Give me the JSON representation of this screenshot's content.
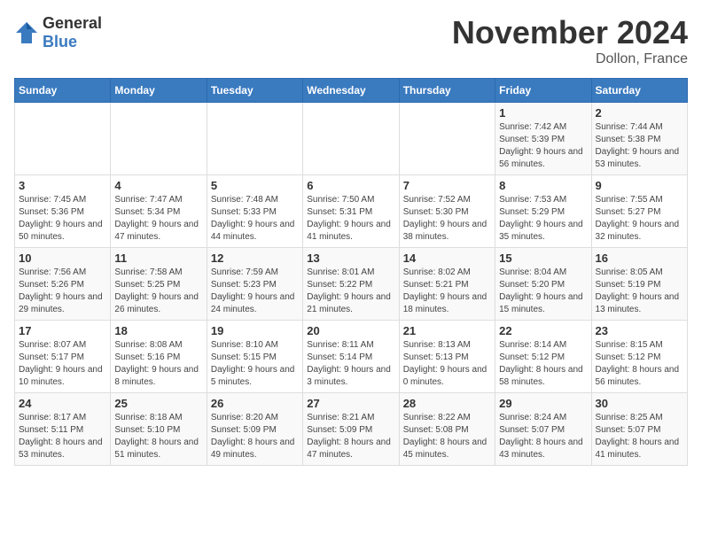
{
  "header": {
    "logo_general": "General",
    "logo_blue": "Blue",
    "month_title": "November 2024",
    "location": "Dollon, France"
  },
  "days_of_week": [
    "Sunday",
    "Monday",
    "Tuesday",
    "Wednesday",
    "Thursday",
    "Friday",
    "Saturday"
  ],
  "weeks": [
    [
      {
        "day": "",
        "info": ""
      },
      {
        "day": "",
        "info": ""
      },
      {
        "day": "",
        "info": ""
      },
      {
        "day": "",
        "info": ""
      },
      {
        "day": "",
        "info": ""
      },
      {
        "day": "1",
        "info": "Sunrise: 7:42 AM\nSunset: 5:39 PM\nDaylight: 9 hours and 56 minutes."
      },
      {
        "day": "2",
        "info": "Sunrise: 7:44 AM\nSunset: 5:38 PM\nDaylight: 9 hours and 53 minutes."
      }
    ],
    [
      {
        "day": "3",
        "info": "Sunrise: 7:45 AM\nSunset: 5:36 PM\nDaylight: 9 hours and 50 minutes."
      },
      {
        "day": "4",
        "info": "Sunrise: 7:47 AM\nSunset: 5:34 PM\nDaylight: 9 hours and 47 minutes."
      },
      {
        "day": "5",
        "info": "Sunrise: 7:48 AM\nSunset: 5:33 PM\nDaylight: 9 hours and 44 minutes."
      },
      {
        "day": "6",
        "info": "Sunrise: 7:50 AM\nSunset: 5:31 PM\nDaylight: 9 hours and 41 minutes."
      },
      {
        "day": "7",
        "info": "Sunrise: 7:52 AM\nSunset: 5:30 PM\nDaylight: 9 hours and 38 minutes."
      },
      {
        "day": "8",
        "info": "Sunrise: 7:53 AM\nSunset: 5:29 PM\nDaylight: 9 hours and 35 minutes."
      },
      {
        "day": "9",
        "info": "Sunrise: 7:55 AM\nSunset: 5:27 PM\nDaylight: 9 hours and 32 minutes."
      }
    ],
    [
      {
        "day": "10",
        "info": "Sunrise: 7:56 AM\nSunset: 5:26 PM\nDaylight: 9 hours and 29 minutes."
      },
      {
        "day": "11",
        "info": "Sunrise: 7:58 AM\nSunset: 5:25 PM\nDaylight: 9 hours and 26 minutes."
      },
      {
        "day": "12",
        "info": "Sunrise: 7:59 AM\nSunset: 5:23 PM\nDaylight: 9 hours and 24 minutes."
      },
      {
        "day": "13",
        "info": "Sunrise: 8:01 AM\nSunset: 5:22 PM\nDaylight: 9 hours and 21 minutes."
      },
      {
        "day": "14",
        "info": "Sunrise: 8:02 AM\nSunset: 5:21 PM\nDaylight: 9 hours and 18 minutes."
      },
      {
        "day": "15",
        "info": "Sunrise: 8:04 AM\nSunset: 5:20 PM\nDaylight: 9 hours and 15 minutes."
      },
      {
        "day": "16",
        "info": "Sunrise: 8:05 AM\nSunset: 5:19 PM\nDaylight: 9 hours and 13 minutes."
      }
    ],
    [
      {
        "day": "17",
        "info": "Sunrise: 8:07 AM\nSunset: 5:17 PM\nDaylight: 9 hours and 10 minutes."
      },
      {
        "day": "18",
        "info": "Sunrise: 8:08 AM\nSunset: 5:16 PM\nDaylight: 9 hours and 8 minutes."
      },
      {
        "day": "19",
        "info": "Sunrise: 8:10 AM\nSunset: 5:15 PM\nDaylight: 9 hours and 5 minutes."
      },
      {
        "day": "20",
        "info": "Sunrise: 8:11 AM\nSunset: 5:14 PM\nDaylight: 9 hours and 3 minutes."
      },
      {
        "day": "21",
        "info": "Sunrise: 8:13 AM\nSunset: 5:13 PM\nDaylight: 9 hours and 0 minutes."
      },
      {
        "day": "22",
        "info": "Sunrise: 8:14 AM\nSunset: 5:12 PM\nDaylight: 8 hours and 58 minutes."
      },
      {
        "day": "23",
        "info": "Sunrise: 8:15 AM\nSunset: 5:12 PM\nDaylight: 8 hours and 56 minutes."
      }
    ],
    [
      {
        "day": "24",
        "info": "Sunrise: 8:17 AM\nSunset: 5:11 PM\nDaylight: 8 hours and 53 minutes."
      },
      {
        "day": "25",
        "info": "Sunrise: 8:18 AM\nSunset: 5:10 PM\nDaylight: 8 hours and 51 minutes."
      },
      {
        "day": "26",
        "info": "Sunrise: 8:20 AM\nSunset: 5:09 PM\nDaylight: 8 hours and 49 minutes."
      },
      {
        "day": "27",
        "info": "Sunrise: 8:21 AM\nSunset: 5:09 PM\nDaylight: 8 hours and 47 minutes."
      },
      {
        "day": "28",
        "info": "Sunrise: 8:22 AM\nSunset: 5:08 PM\nDaylight: 8 hours and 45 minutes."
      },
      {
        "day": "29",
        "info": "Sunrise: 8:24 AM\nSunset: 5:07 PM\nDaylight: 8 hours and 43 minutes."
      },
      {
        "day": "30",
        "info": "Sunrise: 8:25 AM\nSunset: 5:07 PM\nDaylight: 8 hours and 41 minutes."
      }
    ]
  ]
}
